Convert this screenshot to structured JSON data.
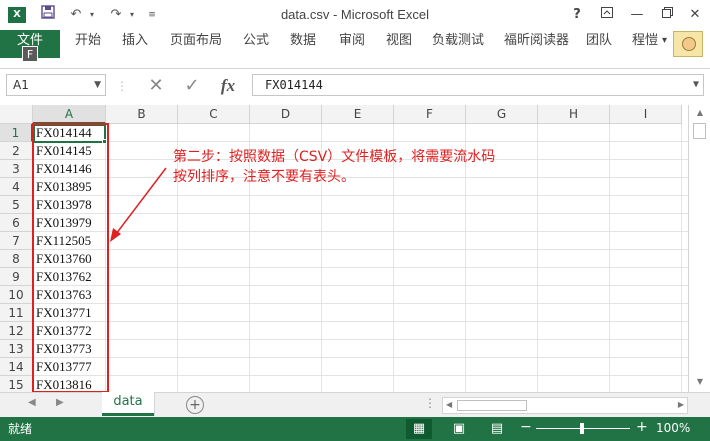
{
  "window": {
    "title": "data.csv - Microsoft Excel",
    "app_icon": "X",
    "icons": {
      "save": "save-icon",
      "undo": "undo-icon",
      "redo": "redo-icon",
      "customize": "customize-qat-icon",
      "help": "help-icon",
      "ribbon_display": "ribbon-display-icon",
      "minimize": "minimize-icon",
      "restore": "restore-icon",
      "close": "close-icon"
    }
  },
  "ribbon": {
    "file_tab": "文件",
    "file_keytip": "F",
    "tabs": [
      "开始",
      "插入",
      "页面布局",
      "公式",
      "数据",
      "审阅",
      "视图",
      "负载测试",
      "福昕阅读器",
      "团队",
      "程愷"
    ],
    "overflow_arrow": "▾"
  },
  "formula_bar": {
    "name_box": "A1",
    "cancel": "✕",
    "enter": "✓",
    "fx": "fx",
    "value": "FX014144"
  },
  "grid": {
    "columns": [
      "A",
      "B",
      "C",
      "D",
      "E",
      "F",
      "G",
      "H",
      "I"
    ],
    "rows": [
      "1",
      "2",
      "3",
      "4",
      "5",
      "6",
      "7",
      "8",
      "9",
      "10",
      "11",
      "12",
      "13",
      "14",
      "15"
    ],
    "column_a_values": [
      "FX014144",
      "FX014145",
      "FX014146",
      "FX013895",
      "FX013978",
      "FX013979",
      "FX112505",
      "FX013760",
      "FX013762",
      "FX013763",
      "FX013771",
      "FX013772",
      "FX013773",
      "FX013777",
      "FX013816"
    ],
    "selected_cell": "A1"
  },
  "annotation": {
    "text": "第二步：按照数据（CSV）文件模板，将需要流水码按列排序，注意不要有表头。",
    "color": "#e02020"
  },
  "sheets": {
    "tabs": [
      "data"
    ],
    "active": "data",
    "add_label": "+"
  },
  "status": {
    "ready": "就绪",
    "zoom": "100%",
    "zoom_fraction": 1.0,
    "minus": "−",
    "plus": "+"
  },
  "colors": {
    "accent": "#217346",
    "annotation_red": "#e02020"
  }
}
